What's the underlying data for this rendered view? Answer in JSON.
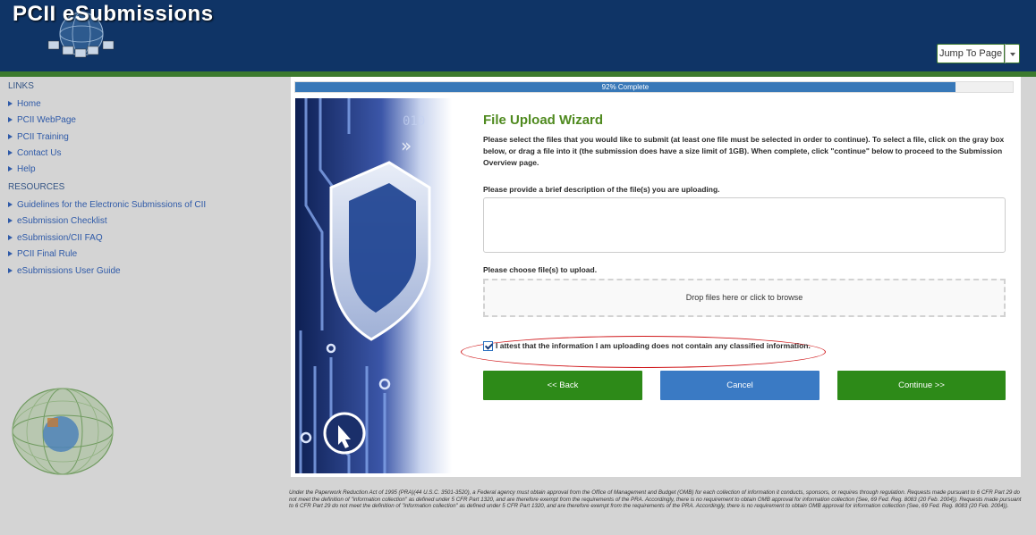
{
  "header": {
    "logo_text": "PCII eSubmissions",
    "jump_button_label": "Jump To Page"
  },
  "sidebar": {
    "links_heading": "LINKS",
    "links": [
      {
        "label": "Home"
      },
      {
        "label": "PCII WebPage"
      },
      {
        "label": "PCII Training"
      },
      {
        "label": "Contact Us"
      },
      {
        "label": "Help"
      }
    ],
    "resources_heading": "RESOURCES",
    "resources": [
      {
        "label": "Guidelines for the Electronic Submissions of CII"
      },
      {
        "label": "eSubmission Checklist"
      },
      {
        "label": "eSubmission/CII FAQ"
      },
      {
        "label": "PCII Final Rule"
      },
      {
        "label": "eSubmissions User Guide"
      }
    ]
  },
  "progress": {
    "value": 0.92,
    "label": "92% Complete"
  },
  "wizard": {
    "title": "File Upload Wizard",
    "instructions": "Please select the files that you would like to submit (at least one file must be selected in order to continue). To select a file, click on the gray box below, or drag a file into it (the submission does have a size limit of 1GB). When complete, click \"continue\" below to proceed to the Submission Overview page.",
    "description_label": "Please provide a brief description of the file(s) you are uploading.",
    "description_value": "",
    "files_label": "Please choose file(s) to upload.",
    "dropzone_text": "Drop files here or click to browse",
    "attest_checked": true,
    "attest_label": "I attest that the information I am uploading does not contain any classified information.",
    "back_label": "<< Back",
    "cancel_label": "Cancel",
    "continue_label": "Continue >>"
  },
  "colors": {
    "header_bg": "#0f3466",
    "accent_green": "#2d8a18",
    "accent_blue": "#3a7ac4",
    "highlight_red": "#d0181b"
  },
  "footer": {
    "text": "Under the Paperwork Reduction Act of 1995 (PRA)(44 U.S.C. 3501-3520), a Federal agency must obtain approval from the Office of Management and Budget (OMB) for each collection of information it conducts, sponsors, or requires through regulation. Requests made pursuant to 6 CFR Part 29 do not meet the definition of \"information collection\" as defined under 5 CFR Part 1320, and are therefore exempt from the requirements of the PRA. Accordingly, there is no requirement to obtain OMB approval for information collection (See, 69 Fed. Reg. 8083 (20 Feb. 2004)). Requests made pursuant to 6 CFR Part 29 do not meet the definition of \"information collection\" as defined under 5 CFR Part 1320, and are therefore exempt from the requirements of the PRA. Accordingly, there is no requirement to obtain OMB approval for information collection (See, 69 Fed. Reg. 8083 (20 Feb. 2004))."
  }
}
